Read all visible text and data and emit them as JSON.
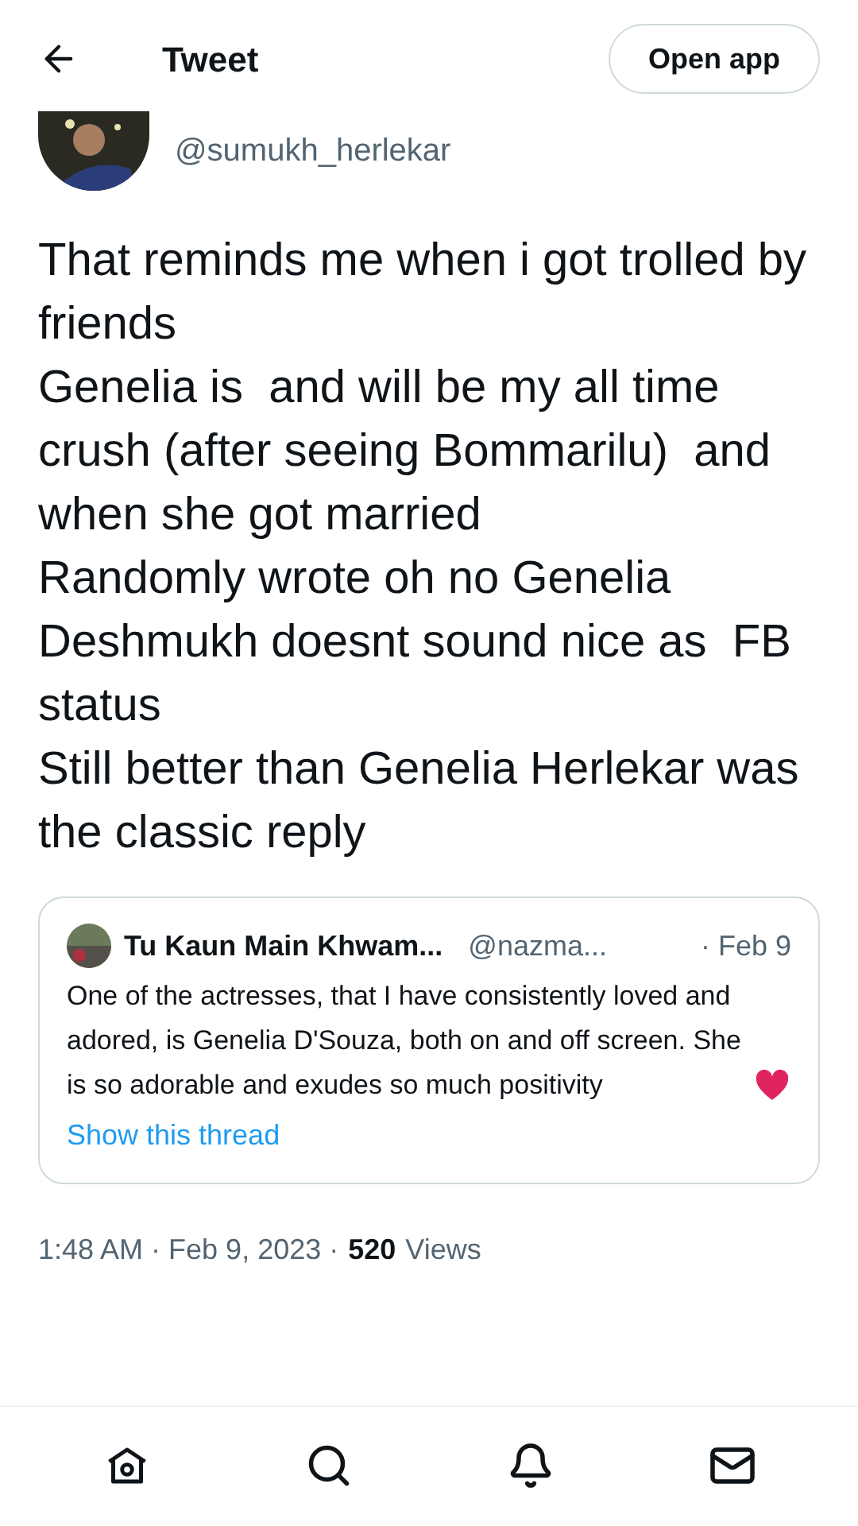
{
  "header": {
    "title": "Tweet",
    "open_app": "Open app"
  },
  "author": {
    "handle": "@sumukh_herlekar"
  },
  "tweet_text": "That reminds me when i got trolled by friends\nGenelia is  and will be my all time crush (after seeing Bommarilu)  and when she got married\nRandomly wrote oh no Genelia Deshmukh doesnt sound nice as  FB status\nStill better than Genelia Herlekar was the classic reply",
  "quote": {
    "name": "Tu Kaun Main Khwam...",
    "handle": "@nazma...",
    "date": "· Feb 9",
    "text": "One of the actresses, that I have consistently loved and adored, is Genelia D'Souza, both on and off screen. She is so adorable and exudes so much positivity",
    "link": "Show this thread"
  },
  "meta": {
    "time": "1:48 AM · Feb 9, 2023 ·",
    "views_count": "520",
    "views_label": "Views"
  },
  "nav": [
    {
      "kind": "home"
    },
    {
      "kind": "search"
    },
    {
      "kind": "bell"
    },
    {
      "kind": "mail"
    }
  ]
}
